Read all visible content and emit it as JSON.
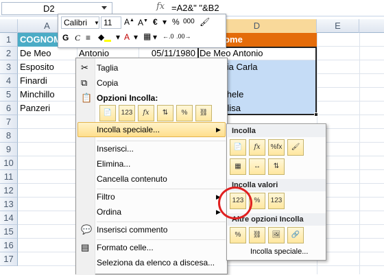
{
  "formula_bar": {
    "name_box": "D2",
    "fx": "fx",
    "formula": "=A2&\" \"&B2"
  },
  "columns": [
    "A",
    "B",
    "C",
    "D",
    "E"
  ],
  "rows": [
    {
      "num": "1",
      "a": "COGNOM",
      "d": "omeNome"
    },
    {
      "num": "2",
      "a": "De Meo",
      "b": "Antonio",
      "c": "05/11/1980",
      "d": "De Meo Antonio"
    },
    {
      "num": "3",
      "a": "Esposito",
      "d": "ito Maria Carla"
    },
    {
      "num": "4",
      "a": "Finardi",
      "d": "li Luigi"
    },
    {
      "num": "5",
      "a": "Minchillo",
      "d": "illo Michele"
    },
    {
      "num": "6",
      "a": "Panzeri",
      "d": "ri Annalisa"
    },
    {
      "num": "7"
    },
    {
      "num": "8"
    },
    {
      "num": "9"
    },
    {
      "num": "10"
    },
    {
      "num": "11"
    },
    {
      "num": "12"
    },
    {
      "num": "13"
    },
    {
      "num": "14"
    },
    {
      "num": "15"
    },
    {
      "num": "16"
    },
    {
      "num": "17"
    }
  ],
  "mini_toolbar": {
    "font": "Calibri",
    "size": "11",
    "bold": "G",
    "italic": "C",
    "pct": "%",
    "thousands": "000"
  },
  "context_menu": {
    "cut": "Taglia",
    "copy": "Copia",
    "paste_options_header": "Opzioni Incolla:",
    "paste_special": "Incolla speciale...",
    "insert": "Inserisci...",
    "delete": "Elimina...",
    "clear": "Cancella contenuto",
    "filter": "Filtro",
    "sort": "Ordina",
    "insert_comment": "Inserisci commento",
    "format_cells": "Formato celle...",
    "pick_list": "Seleziona da elenco a discesa..."
  },
  "submenu": {
    "paste_header": "Incolla",
    "paste_values_header": "Incolla valori",
    "other_header": "Altre opzioni Incolla",
    "paste_special": "Incolla speciale..."
  },
  "colors": {
    "header_fill": "#4bacc6",
    "d_header_fill": "#e46c0a",
    "selection": "#c5dcf6"
  }
}
